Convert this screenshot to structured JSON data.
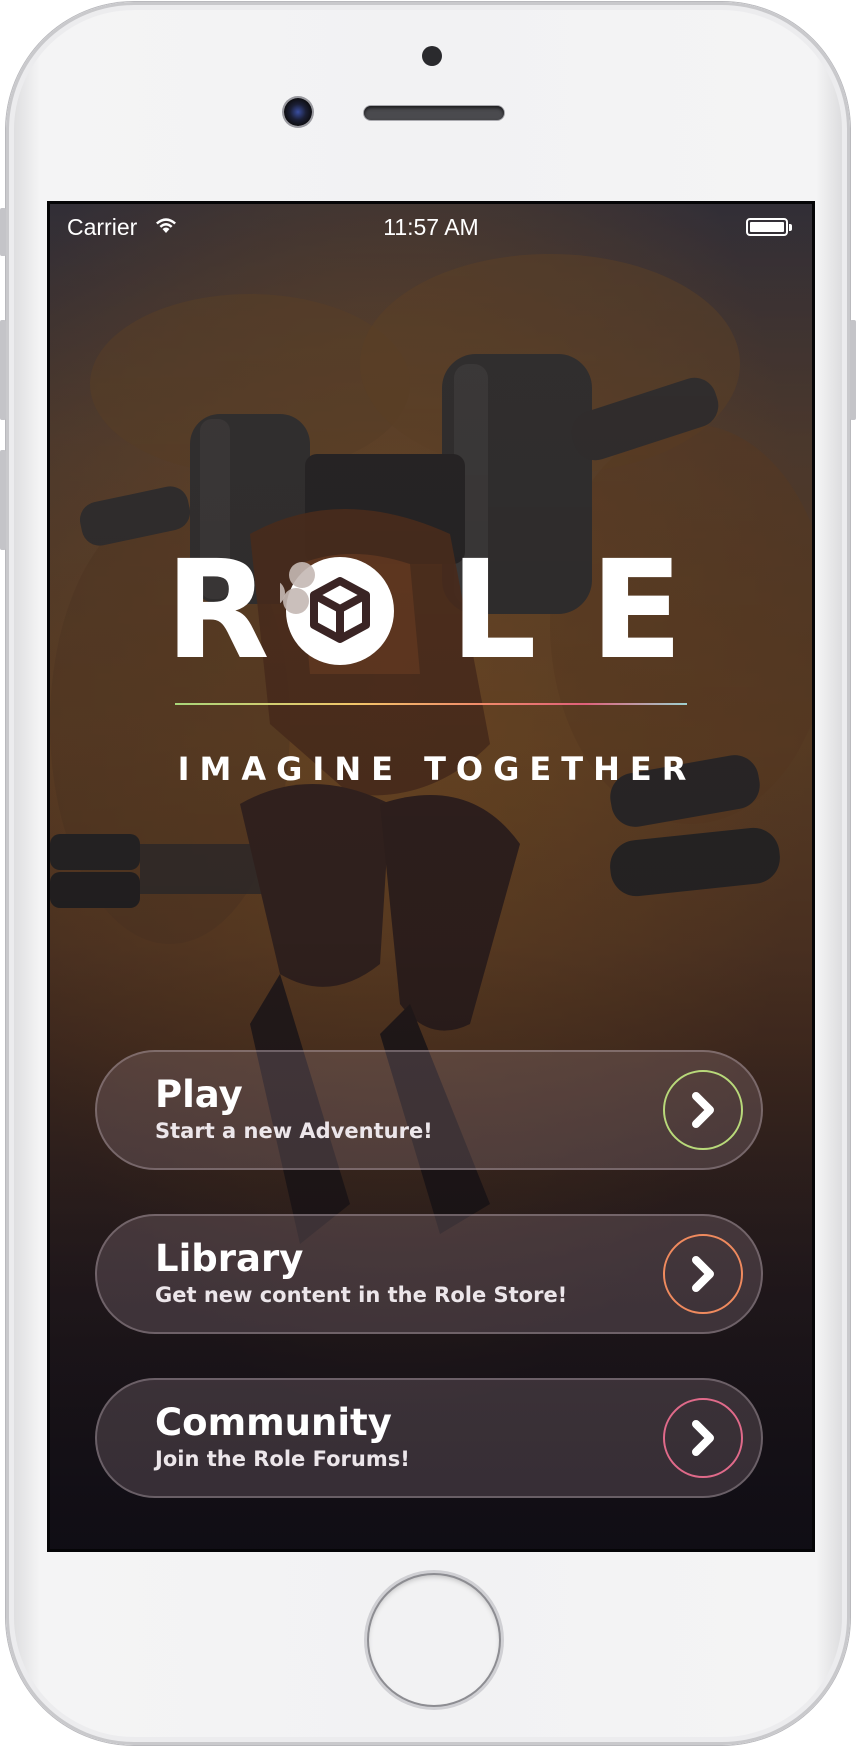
{
  "status_bar": {
    "carrier": "Carrier",
    "time": "11:57 AM",
    "wifi_icon": "wifi-icon",
    "battery_icon": "battery-full-icon"
  },
  "logo": {
    "letters": [
      "R",
      "L",
      "E"
    ],
    "emblem_icon": "cube-icon",
    "tagline": "IMAGINE TOGETHER"
  },
  "menu": [
    {
      "title": "Play",
      "subtitle": "Start a new Adventure!",
      "icon": "chevron-right-icon",
      "ring_color": "#b8d97a"
    },
    {
      "title": "Library",
      "subtitle": "Get new content in the Role Store!",
      "icon": "chevron-right-icon",
      "ring_color": "#ef8a5e"
    },
    {
      "title": "Community",
      "subtitle": "Join the Role Forums!",
      "icon": "chevron-right-icon",
      "ring_color": "#e06a8a"
    }
  ],
  "colors": {
    "accent_green": "#b8d97a",
    "accent_orange": "#ef8a5e",
    "accent_pink": "#e06a8a"
  }
}
